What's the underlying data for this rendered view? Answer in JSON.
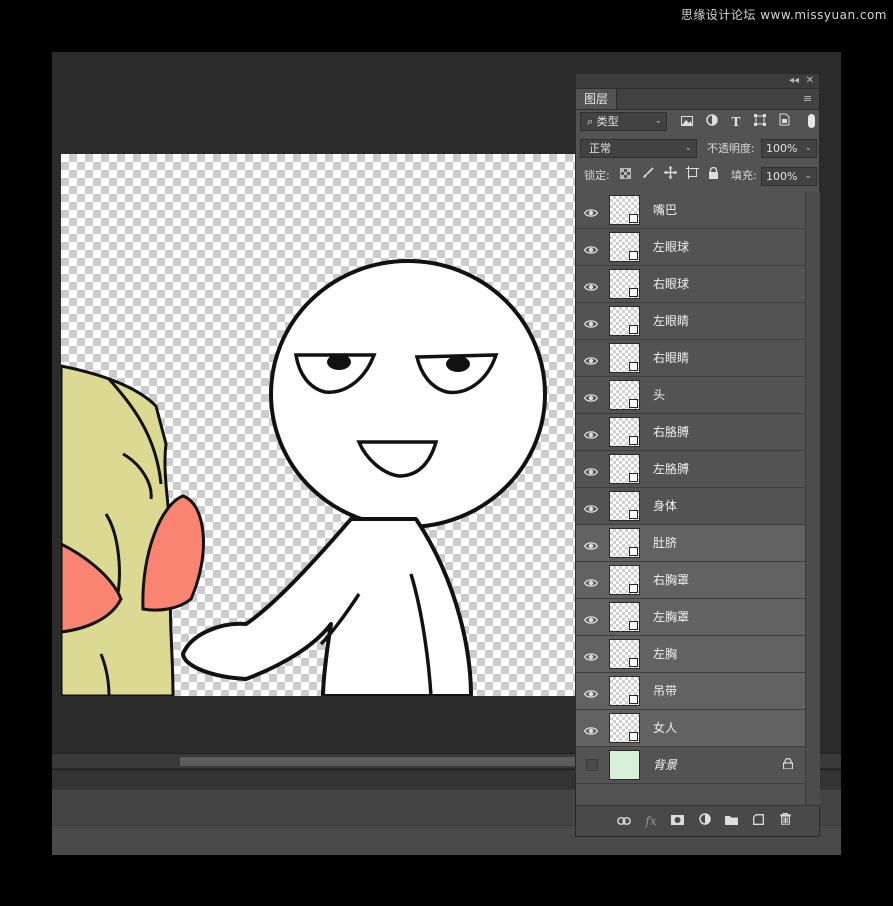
{
  "watermark": "思缘设计论坛 www.missyuan.com",
  "panel": {
    "collapse_glyph": "◂◂",
    "close_glyph": "✕",
    "tab_label": "图层",
    "menu_glyph": "≡",
    "filter": {
      "label": "类型",
      "search_glyph": "⌕",
      "chevron": "⌄"
    },
    "filter_icons": [
      "image-filter-icon",
      "adjustment-filter-icon",
      "type-filter-icon",
      "shape-filter-icon",
      "smartobject-filter-icon"
    ],
    "blend_mode": "正常",
    "opacity_label": "不透明度:",
    "opacity_value": "100%",
    "lock_label": "锁定:",
    "fill_label": "填充:",
    "fill_value": "100%",
    "lock_icons": [
      "lock-transparent-icon",
      "lock-paint-icon",
      "lock-move-icon",
      "lock-artboard-icon",
      "lock-all-icon"
    ],
    "footer_icons": [
      "link-icon",
      "fx-icon",
      "mask-icon",
      "adjustment-icon",
      "folder-icon",
      "new-layer-icon",
      "trash-icon"
    ]
  },
  "layers": [
    {
      "name": "嘴巴",
      "visible": true,
      "selected": false
    },
    {
      "name": "左眼球",
      "visible": true,
      "selected": false
    },
    {
      "name": "右眼球",
      "visible": true,
      "selected": false
    },
    {
      "name": "左眼睛",
      "visible": true,
      "selected": false
    },
    {
      "name": "右眼睛",
      "visible": true,
      "selected": false
    },
    {
      "name": "头",
      "visible": true,
      "selected": false
    },
    {
      "name": "右胳膊",
      "visible": true,
      "selected": false
    },
    {
      "name": "左胳膊",
      "visible": true,
      "selected": false
    },
    {
      "name": "身体",
      "visible": true,
      "selected": false
    },
    {
      "name": "肚脐",
      "visible": true,
      "selected": true
    },
    {
      "name": "右胸罩",
      "visible": true,
      "selected": true
    },
    {
      "name": "左胸罩",
      "visible": true,
      "selected": true
    },
    {
      "name": "左胸",
      "visible": true,
      "selected": true
    },
    {
      "name": "吊带",
      "visible": true,
      "selected": true
    },
    {
      "name": "女人",
      "visible": true,
      "selected": true
    },
    {
      "name": "背景",
      "visible": false,
      "selected": false,
      "locked": true
    }
  ],
  "colors": {
    "skin_yellow": "#dcd993",
    "bra_red": "#fa8472",
    "panel_bg": "#535353",
    "selected_row": "#626262"
  }
}
